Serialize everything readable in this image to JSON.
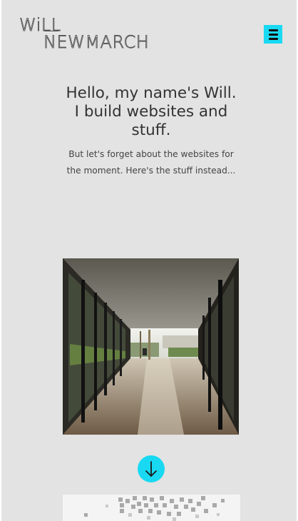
{
  "header": {
    "logo_line1": "WiLL",
    "logo_line2": "NEWMARCH",
    "menu_icon": "hamburger-icon",
    "accent_color": "#19d9f2"
  },
  "hero": {
    "title_lines": [
      "Hello, my name's Will.",
      "I build websites and",
      "stuff."
    ],
    "subtitle_lines": [
      "But let's forget about the websites for",
      "the moment. Here's the stuff instead..."
    ]
  },
  "gallery": {
    "scroll_icon": "arrow-down-icon"
  }
}
